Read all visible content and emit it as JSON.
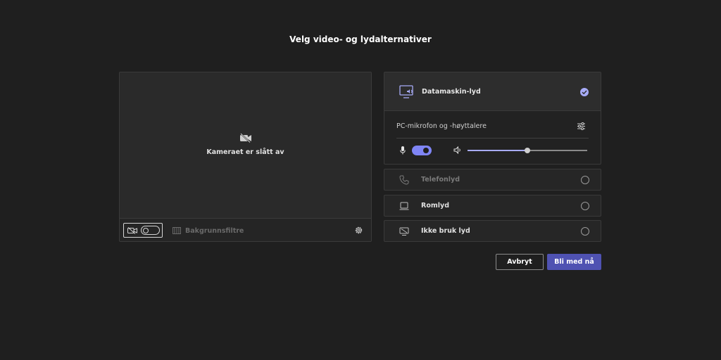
{
  "page": {
    "title": "Velg video- og lydalternativer"
  },
  "video": {
    "camera_off_text": "Kameraet er slått av",
    "camera_toggle_state": "off",
    "background_filters_label": "Bakgrunnsfiltre",
    "icons": {
      "camera_off": "camera-off-icon",
      "camera_toggle": "camera-off-icon",
      "background_filters": "background-filters-icon",
      "settings": "gear-icon"
    }
  },
  "audio": {
    "selected_option": "Datamaskin-lyd",
    "computer": {
      "label": "Datamaskin-lyd",
      "device_label": "PC-mikrofon og -høyttalere",
      "mic_enabled": true,
      "speaker_volume": 0.5
    },
    "options": [
      {
        "label": "Telefonlyd",
        "icon": "phone-icon",
        "selected": false,
        "dimmed": true
      },
      {
        "label": "Romlyd",
        "icon": "room-device-icon",
        "selected": false,
        "dimmed": false
      },
      {
        "label": "Ikke bruk lyd",
        "icon": "audio-off-icon",
        "selected": false,
        "dimmed": false
      }
    ]
  },
  "actions": {
    "cancel_label": "Avbryt",
    "join_label": "Bli med nå"
  },
  "colors": {
    "background": "#1f1f1f",
    "accent": "#7f85f5",
    "primary_button": "#4f52b2"
  }
}
